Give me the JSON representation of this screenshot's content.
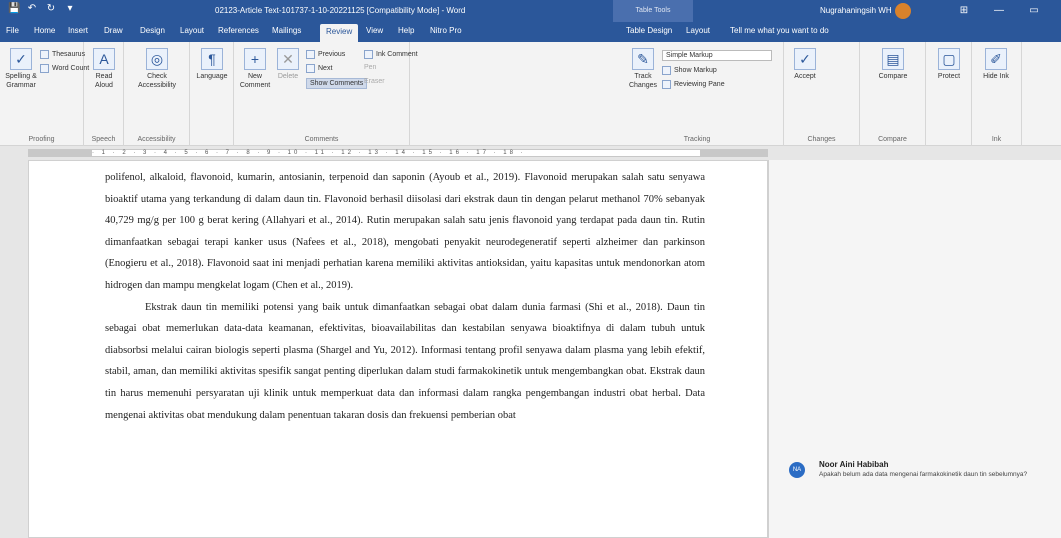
{
  "app": {
    "window_title": "02123-Article Text-101737-1-10-20221125 [Compatibility Mode] - Word",
    "context_label": "Table Tools",
    "user_name": "Nugrahaningsih WH",
    "colors": {
      "accent": "#2b579a",
      "avatar": "#2b6cc4"
    }
  },
  "title_buttons": {
    "ribbon_display": "⊞",
    "minimize": "—",
    "maximize": "▭"
  },
  "qat": {
    "save": "💾",
    "undo": "↶",
    "redo": "↻",
    "autosave": "▾"
  },
  "tabs": [
    {
      "label": "File"
    },
    {
      "label": "Home"
    },
    {
      "label": "Insert"
    },
    {
      "label": "Draw"
    },
    {
      "label": "Design"
    },
    {
      "label": "Layout"
    },
    {
      "label": "References"
    },
    {
      "label": "Mailings"
    },
    {
      "label": "Review"
    },
    {
      "label": "View"
    },
    {
      "label": "Help"
    },
    {
      "label": "Nitro Pro"
    },
    {
      "label": "Table Design"
    },
    {
      "label": "Layout"
    }
  ],
  "tell_me": "Tell me what you want to do",
  "ribbon": {
    "proofing": {
      "spelling": "Spelling & Grammar",
      "thesaurus": "Thesaurus",
      "word_count": "Word Count",
      "label": "Proofing"
    },
    "speech": {
      "read_aloud": "Read Aloud",
      "label": "Speech"
    },
    "accessibility": {
      "check": "Check Accessibility",
      "label": "Accessibility"
    },
    "language": {
      "label": "Language"
    },
    "comments": {
      "new": "New Comment",
      "delete": "Delete",
      "previous": "Previous",
      "next": "Next",
      "show": "Show Comments",
      "ink": "Ink Comment",
      "pen": "Pen",
      "eraser": "Eraser",
      "label": "Comments"
    },
    "tracking": {
      "track_changes": "Track Changes",
      "simple_markup": "Simple Markup",
      "show_markup": "Show Markup",
      "reviewing_pane": "Reviewing Pane",
      "label": "Tracking"
    },
    "changes": {
      "accept": "Accept",
      "label": "Changes"
    },
    "compare": {
      "compare": "Compare",
      "label": "Compare"
    },
    "protect": {
      "protect": "Protect"
    },
    "ink": {
      "hide_ink": "Hide Ink",
      "label": "Ink"
    }
  },
  "ruler": {
    "ticks": "· 1 · 2 · 3 · 4 · 5 · 6 · 7 · 8 · 9 · 10 · 11 · 12 · 13 · 14 · 15 · 16 · 17 · 18 ·"
  },
  "document": {
    "paragraph1": "polifenol, alkaloid, flavonoid, kumarin, antosianin, terpenoid dan saponin (Ayoub et al., 2019). Flavonoid merupakan salah satu senyawa bioaktif utama yang terkandung di dalam daun tin. Flavonoid berhasil diisolasi dari ekstrak daun tin dengan pelarut methanol 70% sebanyak 40,729 mg/g per 100 g berat kering (Allahyari et al., 2014). Rutin merupakan salah satu jenis flavonoid yang terdapat pada daun tin. Rutin dimanfaatkan sebagai terapi kanker usus (Nafees et al., 2018), mengobati penyakit neurodegeneratif seperti alzheimer dan parkinson (Enogieru et al., 2018). Flavonoid saat ini menjadi perhatian karena memiliki aktivitas antioksidan, yaitu kapasitas untuk mendonorkan atom hidrogen dan mampu mengkelat logam (Chen et al., 2019).",
    "paragraph2": "Ekstrak daun tin memiliki potensi yang baik untuk dimanfaatkan sebagai obat dalam dunia farmasi (Shi et al., 2018). Daun tin sebagai obat memerlukan data-data keamanan, efektivitas, bioavailabilitas dan kestabilan senyawa bioaktifnya di dalam tubuh untuk diabsorbsi melalui cairan biologis seperti plasma (Shargel and Yu, 2012). Informasi tentang profil senyawa dalam plasma yang lebih efektif, stabil, aman, dan memiliki aktivitas spesifik sangat penting diperlukan dalam studi farmakokinetik untuk mengembangkan obat. Ekstrak daun tin harus memenuhi persyaratan uji klinik untuk memperkuat data dan informasi dalam rangka pengembangan industri obat herbal. Data mengenai aktivitas obat mendukung dalam penentuan takaran dosis dan frekuensi pemberian obat"
  },
  "comment": {
    "initials": "NA",
    "author": "Noor Aini Habibah",
    "text": "Apakah belum ada data mengenai farmakokinetik daun tin sebelumnya?"
  }
}
